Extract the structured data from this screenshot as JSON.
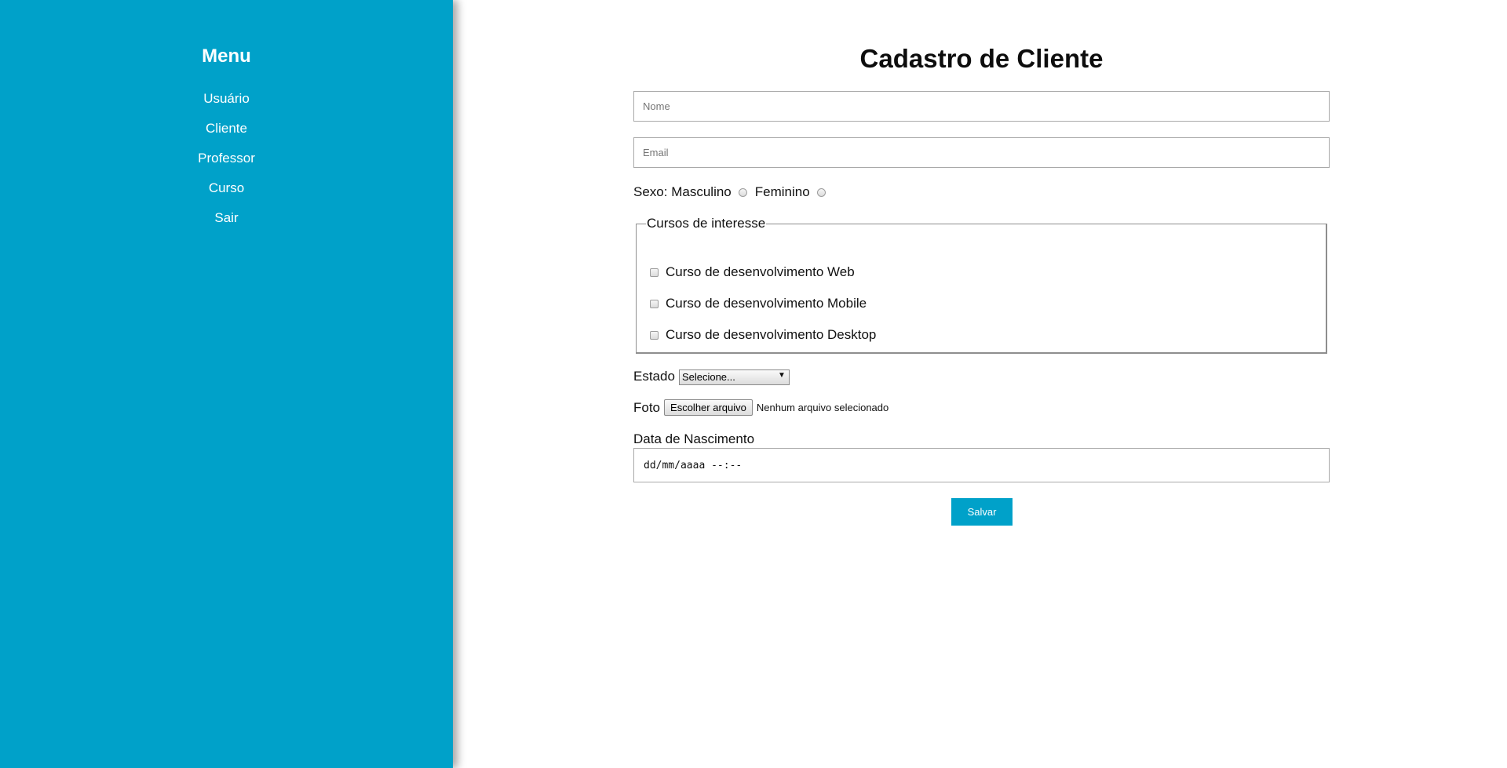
{
  "sidebar": {
    "title": "Menu",
    "items": [
      {
        "label": "Usuário"
      },
      {
        "label": "Cliente"
      },
      {
        "label": "Professor"
      },
      {
        "label": "Curso"
      },
      {
        "label": "Sair"
      }
    ],
    "background_color": "#00a1c9"
  },
  "form": {
    "title": "Cadastro de Cliente",
    "name_placeholder": "Nome",
    "email_placeholder": "Email",
    "sex": {
      "label": "Sexo:",
      "options": [
        "Masculino",
        "Feminino"
      ]
    },
    "interests": {
      "legend": "Cursos de interesse",
      "options": [
        "Curso de desenvolvimento Web",
        "Curso de desenvolvimento Mobile",
        "Curso de desenvolvimento Desktop"
      ]
    },
    "state": {
      "label": "Estado",
      "selected": "Selecione..."
    },
    "photo": {
      "label": "Foto",
      "button": "Escolher arquivo",
      "status": "Nenhum arquivo selecionado"
    },
    "birth_date": {
      "label": "Data de Nascimento",
      "value": "dd/mm/aaaa --:--"
    },
    "save_label": "Salvar",
    "accent_color": "#00a1c9"
  }
}
